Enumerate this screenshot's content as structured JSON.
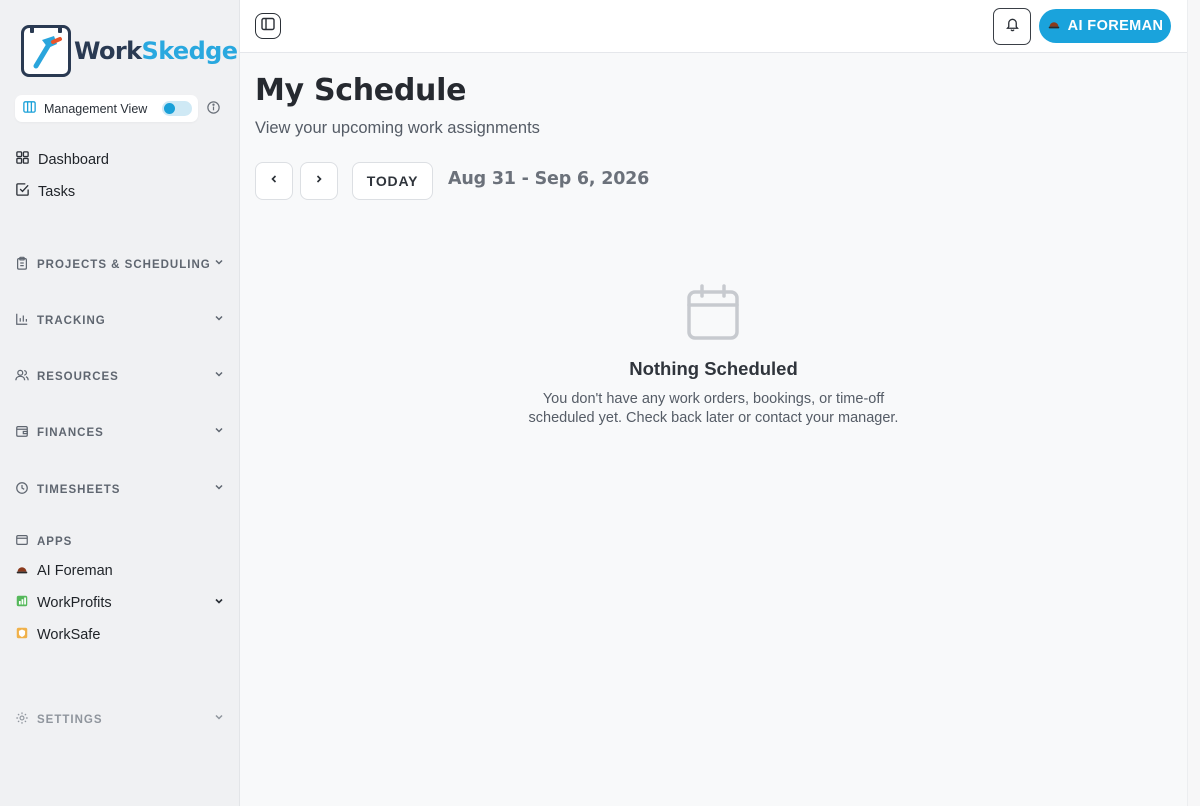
{
  "app": {
    "logo_left": "Work",
    "logo_right": "Skedge"
  },
  "sidebar": {
    "management_view": {
      "label": "Management View",
      "enabled": true
    },
    "items": [
      {
        "label": "Dashboard",
        "icon": "grid-icon"
      },
      {
        "label": "Tasks",
        "icon": "check-square-icon"
      }
    ],
    "sections": [
      {
        "label": "PROJECTS & SCHEDULING",
        "icon": "clipboard-icon"
      },
      {
        "label": "TRACKING",
        "icon": "bar-chart-icon"
      },
      {
        "label": "RESOURCES",
        "icon": "users-icon"
      },
      {
        "label": "FINANCES",
        "icon": "wallet-icon"
      },
      {
        "label": "TIMESHEETS",
        "icon": "clock-icon"
      }
    ],
    "apps_label": "APPS",
    "apps": [
      {
        "label": "AI Foreman",
        "icon": "hardhat-icon"
      },
      {
        "label": "WorkProfits",
        "icon": "workprofits-icon"
      },
      {
        "label": "WorkSafe",
        "icon": "worksafe-icon"
      }
    ],
    "settings_label": "SETTINGS"
  },
  "header": {
    "ai_button_label": "AI FOREMAN"
  },
  "main": {
    "title": "My Schedule",
    "subtitle": "View your upcoming work assignments",
    "today_label": "TODAY",
    "date_range": "Aug 31 - Sep 6, 2026",
    "empty_title": "Nothing Scheduled",
    "empty_text": "You don't have any work orders, bookings, or time-off scheduled yet. Check back later or contact your manager."
  },
  "colors": {
    "accent": "#1aa3dc",
    "brand_dark": "#2a3a52",
    "sidebar_bg": "#f0f1f3",
    "page_bg": "#f8f9fa"
  }
}
